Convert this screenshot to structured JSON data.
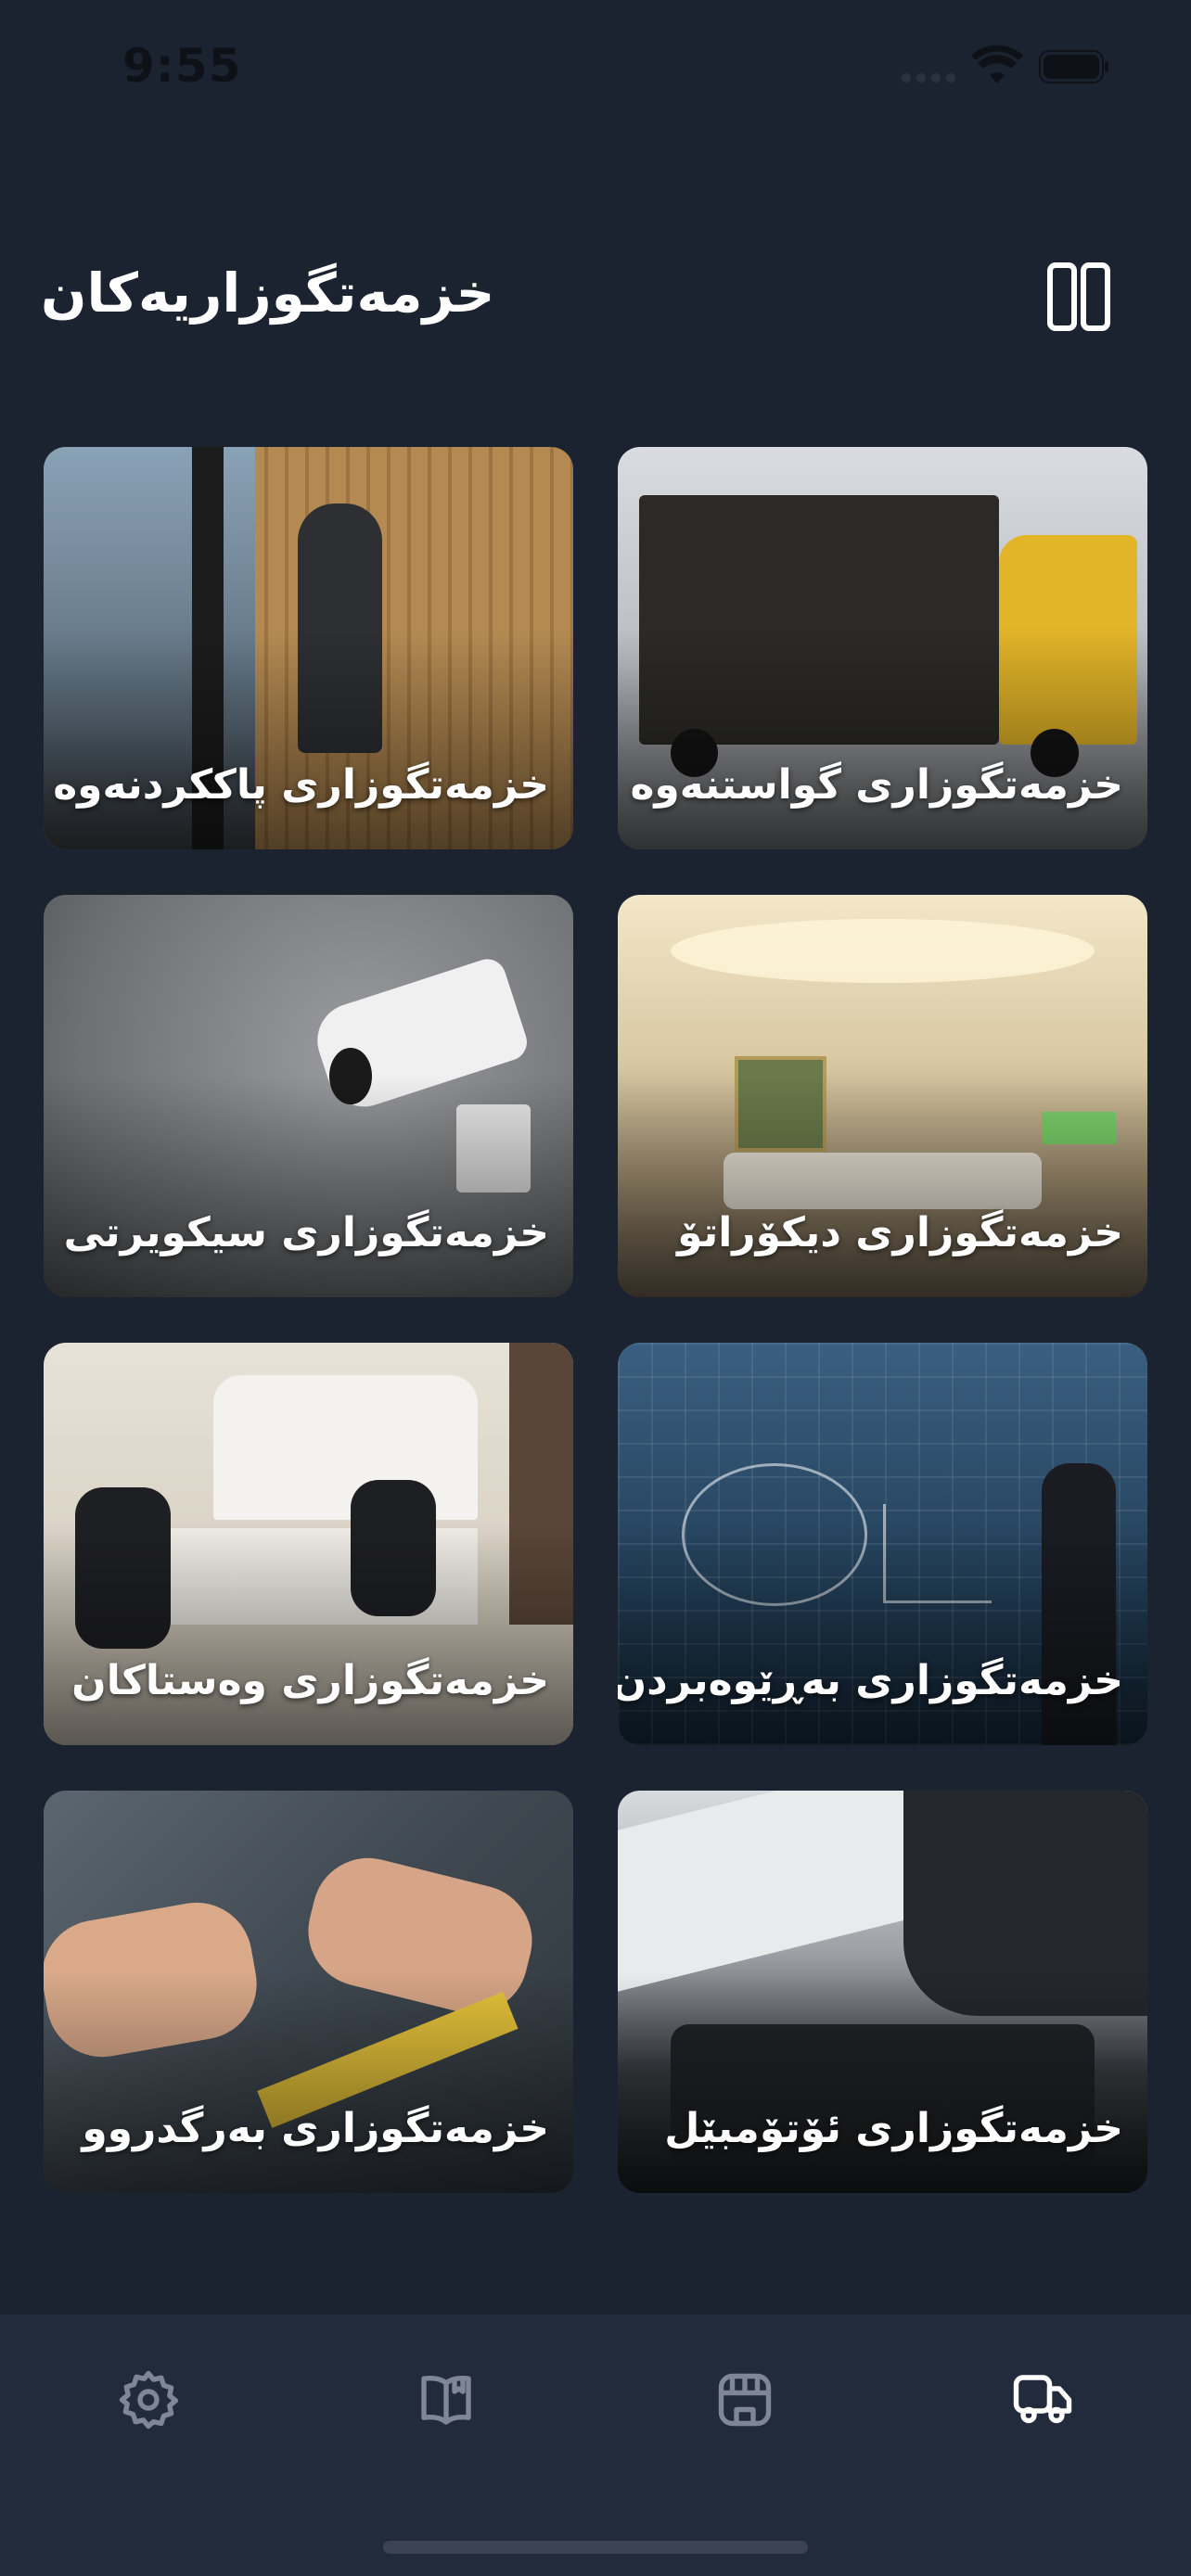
{
  "status": {
    "time": "9:55"
  },
  "header": {
    "title": "خزمەتگوزاریەکان",
    "toggle_icon": "columns-icon"
  },
  "services": [
    {
      "label": "خزمەتگوزاری پاککردنەوە",
      "image": "cleaning-photo"
    },
    {
      "label": "خزمەتگوزاری گواستنەوە",
      "image": "moving-truck-photo"
    },
    {
      "label": "خزمەتگوزاری سیکویرتی",
      "image": "security-camera-photo"
    },
    {
      "label": "خزمەتگوزاری دیکۆراتۆ",
      "image": "decor-interior-photo"
    },
    {
      "label": "خزمەتگوزاری وەستاکان",
      "image": "craftsmen-photo"
    },
    {
      "label": "خزمەتگوزاری بەڕێوەبردن",
      "image": "management-ideas-photo"
    },
    {
      "label": "خزمەتگوزاری بەرگدروو",
      "image": "tailoring-photo"
    },
    {
      "label": "خزمەتگوزاری ئۆتۆمبێل",
      "image": "car-repair-photo"
    }
  ],
  "tabs": [
    {
      "icon": "gear-icon",
      "active": false
    },
    {
      "icon": "book-icon",
      "active": false
    },
    {
      "icon": "store-icon",
      "active": false
    },
    {
      "icon": "truck-icon",
      "active": true
    }
  ],
  "colors": {
    "background": "#1c2330",
    "tab_bar": "#222b3b",
    "icon_inactive": "#7f8796",
    "icon_active": "#ffffff"
  }
}
